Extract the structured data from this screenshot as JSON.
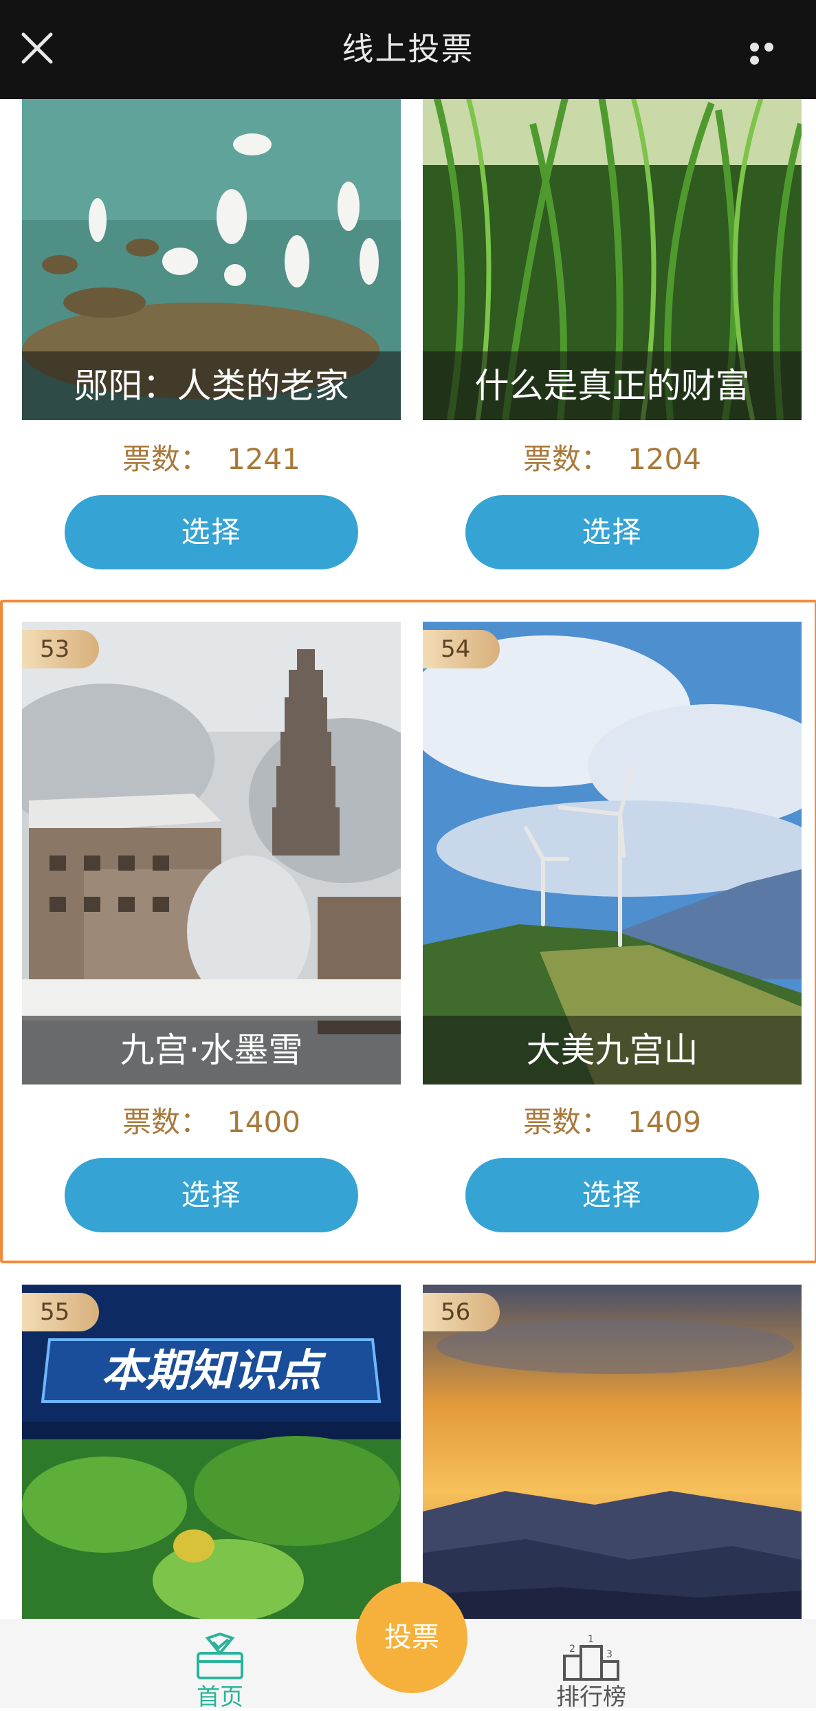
{
  "header": {
    "title": "线上投票",
    "close_icon": "close-icon",
    "more_icon": "more-icon"
  },
  "cards": [
    {
      "badge": "",
      "caption": "郧阳：人类的老家",
      "votes_label": "票数：",
      "votes": "1241",
      "button": "选择"
    },
    {
      "badge": "",
      "caption": "什么是真正的财富",
      "votes_label": "票数：",
      "votes": "1204",
      "button": "选择"
    },
    {
      "badge": "53",
      "caption": "九宫·水墨雪",
      "votes_label": "票数：",
      "votes": "1400",
      "button": "选择"
    },
    {
      "badge": "54",
      "caption": "大美九宫山",
      "votes_label": "票数：",
      "votes": "1409",
      "button": "选择"
    },
    {
      "badge": "55",
      "banner_text": "本期知识点"
    },
    {
      "badge": "56"
    }
  ],
  "bottom_nav": {
    "home": "首页",
    "vote": "投票",
    "ranking": "排行榜",
    "ranking_digits": [
      "2",
      "1",
      "3"
    ]
  },
  "colors": {
    "button": "#35a3d4",
    "votes_text": "#a8793a",
    "highlight_border": "#f08b3a",
    "vote_fab": "#f6b13c",
    "home_active": "#2bb39b",
    "topbar": "#121212"
  }
}
